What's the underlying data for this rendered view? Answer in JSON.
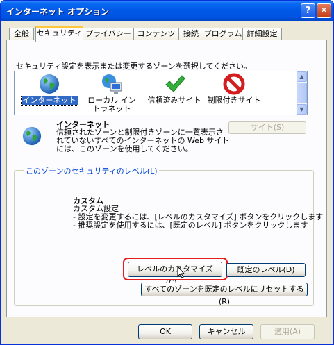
{
  "window": {
    "title": "インターネット オプション",
    "help_label": "?",
    "close_label": "✕"
  },
  "tabs": [
    {
      "label": "全般"
    },
    {
      "label": "セキュリティ",
      "active": true
    },
    {
      "label": "プライバシー"
    },
    {
      "label": "コンテンツ"
    },
    {
      "label": "接続"
    },
    {
      "label": "プログラム"
    },
    {
      "label": "詳細設定"
    }
  ],
  "zone_prompt": "セキュリティ設定を表示または変更するゾーンを選択してください。",
  "zones": [
    {
      "label": "インターネット",
      "icon": "globe-icon",
      "selected": true
    },
    {
      "label": "ローカル イントラネット",
      "icon": "local-intranet-icon"
    },
    {
      "label": "信頼済みサイト",
      "icon": "green-checkmark-icon"
    },
    {
      "label": "制限付きサイト",
      "icon": "restricted-icon"
    }
  ],
  "zone_info": {
    "title": "インターネット",
    "description": "信頼されたゾーンと制限付きゾーンに一覧表示されていないすべてのインターネットの Web サイトには、このゾーンを使用してください。",
    "sites_button": "サイト(S)"
  },
  "security_level": {
    "legend": "このゾーンのセキュリティのレベル(L)",
    "title": "カスタム",
    "lines": [
      "カスタム設定",
      "- 設定を変更するには、[レベルのカスタマイズ] ボタンをクリックします",
      "- 推奨設定を使用するには、[既定のレベル] ボタンをクリックします"
    ],
    "custom_level_button": "レベルのカスタマイズ(C)...",
    "default_level_button": "既定のレベル(D)",
    "reset_all_button": "すべてのゾーンを既定のレベルにリセットする(R)"
  },
  "footer": {
    "ok": "OK",
    "cancel": "キャンセル",
    "apply": "適用(A)"
  },
  "colors": {
    "title_bar": "#0054e3",
    "selection": "#316ac5",
    "highlight_box": "#e31c1c",
    "group_legend": "#0046d5"
  }
}
